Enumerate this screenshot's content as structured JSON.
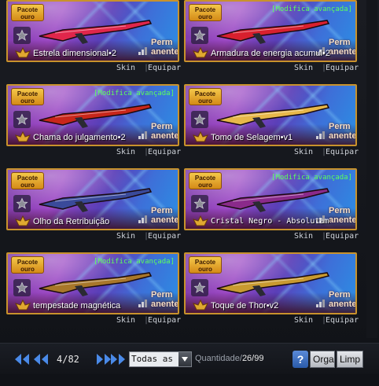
{
  "items": [
    {
      "badge": "Pacote ouro",
      "name": "Estrela dimensional•2",
      "mod": "",
      "perm": "Perm anente",
      "skin": "Skin",
      "equip": "Equipar",
      "weapon_color": "#e0264b"
    },
    {
      "badge": "Pacote ouro",
      "name": "Armadura de energia acumul•2",
      "mod": "[Modifica avançada]",
      "perm": "Perm anente",
      "skin": "Skin",
      "equip": "Equipar",
      "weapon_color": "#d8202e"
    },
    {
      "badge": "Pacote ouro",
      "name": "Chama do julgamento•2",
      "mod": "[Modifica avançada]",
      "perm": "Perm anente",
      "skin": "Skin",
      "equip": "Equipar",
      "weapon_color": "#c8261a"
    },
    {
      "badge": "Pacote ouro",
      "name": "Tomo de Selagem•v1",
      "mod": "",
      "perm": "Perm anente",
      "skin": "Skin",
      "equip": "Equipar",
      "weapon_color": "#e7b84a"
    },
    {
      "badge": "Pacote ouro",
      "name": "Olho da Retribuição",
      "mod": "",
      "perm": "Perm anente",
      "skin": "Skin",
      "equip": "Equipar",
      "weapon_color": "#3a4a9a"
    },
    {
      "badge": "Pacote ouro",
      "name": "Cristal Negro - Absolutam",
      "mod": "[Modifica avançada]",
      "perm": "Perm anente",
      "skin": "Skin",
      "equip": "Equipar",
      "weapon_color": "#8a2a8a"
    },
    {
      "badge": "Pacote ouro",
      "name": "tempestade magnética",
      "mod": "[Modifica avançada]",
      "perm": "Perm anente",
      "skin": "Skin",
      "equip": "Equipar",
      "weapon_color": "#a8772a"
    },
    {
      "badge": "Pacote ouro",
      "name": "Toque de Thor•v2",
      "mod": "",
      "perm": "Perm anente",
      "skin": "Skin",
      "equip": "Equipar",
      "weapon_color": "#c89a30"
    }
  ],
  "footer": {
    "page": "4/82",
    "filter_value": "Todas as c",
    "quantity_label": "Quantidade/",
    "quantity_value": "26/99",
    "help": "?",
    "organize": "Orga",
    "clear": "Limp"
  },
  "colors": {
    "accent_gold": "#c8922c",
    "mod_green": "#5cff5c",
    "nav_blue": "#4a8ae8"
  }
}
